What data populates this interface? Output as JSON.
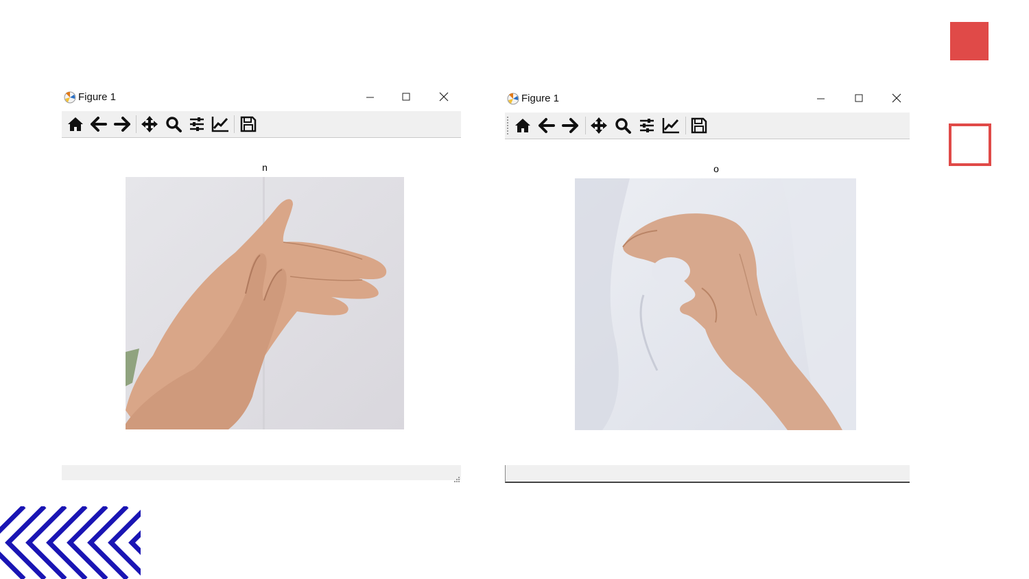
{
  "colors": {
    "accent_red": "#e04a48",
    "accent_blue": "#1a15b4",
    "toolbar_bg": "#f0f0f0"
  },
  "windows": [
    {
      "title": "Figure 1",
      "figure_title": "n",
      "image_description_icon": "hand-sign-image",
      "toolbar": [
        "home-icon",
        "back-arrow-icon",
        "forward-arrow-icon",
        "pan-icon",
        "zoom-icon",
        "subplots-icon",
        "axes-edit-icon",
        "save-icon"
      ]
    },
    {
      "title": "Figure 1",
      "figure_title": "o",
      "image_description_icon": "hand-sign-image",
      "toolbar": [
        "home-icon",
        "back-arrow-icon",
        "forward-arrow-icon",
        "pan-icon",
        "zoom-icon",
        "subplots-icon",
        "axes-edit-icon",
        "save-icon"
      ]
    }
  ]
}
